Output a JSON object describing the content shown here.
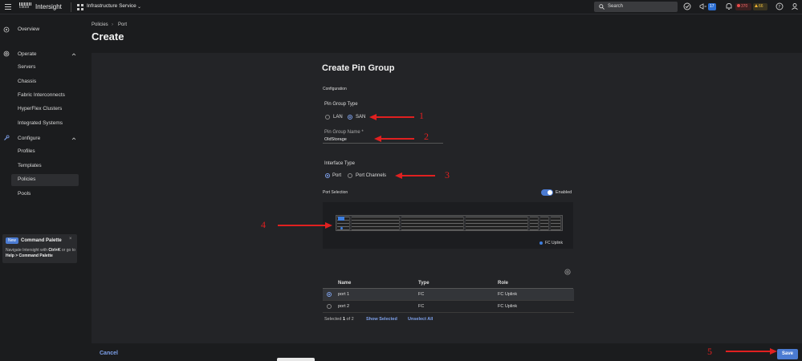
{
  "topbar": {
    "cisco": "cisco",
    "app_name": "Intersight",
    "service": "Infrastructure Service",
    "search_label": "Search",
    "megaphone_count": "17",
    "critical_count": "370",
    "warning_count": "66"
  },
  "sidebar": {
    "overview": "Overview",
    "operate": "Operate",
    "operate_items": [
      "Servers",
      "Chassis",
      "Fabric Interconnects",
      "HyperFlex Clusters",
      "Integrated Systems"
    ],
    "configure": "Configure",
    "configure_items": [
      "Profiles",
      "Templates",
      "Policies",
      "Pools"
    ],
    "command_palette": {
      "badge": "New",
      "title": "Command Palette",
      "text_before": "Navigate Intersight with ",
      "shortcut": "Ctrl+K",
      "text_middle": " or go to ",
      "path": "Help > Command Palette"
    }
  },
  "header": {
    "breadcrumb": [
      "Policies",
      "Port"
    ],
    "title": "Create"
  },
  "form": {
    "title": "Create Pin Group",
    "configuration_label": "Configuration",
    "pin_group_type": {
      "label": "Pin Group Type",
      "options": [
        "LAN",
        "SAN"
      ],
      "selected": "SAN"
    },
    "pin_group_name": {
      "label": "Pin Group Name *",
      "value": "OldStorage"
    },
    "interface_type": {
      "label": "Interface Type",
      "options": [
        "Port",
        "Port Channels"
      ],
      "selected": "Port"
    },
    "port_selection": {
      "label": "Port Selection",
      "toggle_label": "Enabled",
      "toggle_on": true,
      "legend": "FC Uplink",
      "legend_color": "#3d7ee0"
    },
    "table": {
      "headers": [
        "Name",
        "Type",
        "Role"
      ],
      "rows": [
        {
          "name": "port 1",
          "type": "FC",
          "role": "FC Uplink",
          "selected": true
        },
        {
          "name": "port 2",
          "type": "FC",
          "role": "FC Uplink",
          "selected": false
        }
      ],
      "selected_prefix": "Selected ",
      "selected_count": "1",
      "selected_of": " of 2",
      "show_selected": "Show Selected",
      "unselect_all": "Unselect All"
    }
  },
  "footer": {
    "cancel": "Cancel",
    "save": "Save"
  },
  "annotations": [
    "1",
    "2",
    "3",
    "4",
    "5"
  ],
  "colors": {
    "accent": "#4b7bd2",
    "annotation": "#e02020"
  }
}
